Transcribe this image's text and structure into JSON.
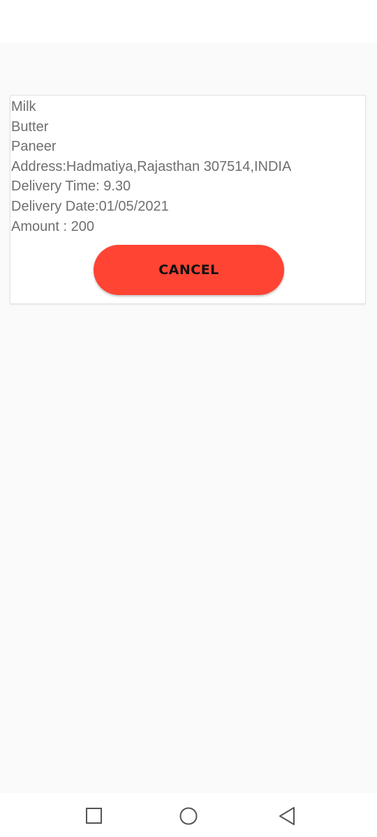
{
  "order": {
    "items": [
      "Milk",
      "Butter",
      "Paneer"
    ],
    "address": "Address:Hadmatiya,Rajasthan 307514,INDIA",
    "delivery_time": "Delivery Time: 9.30",
    "delivery_date": "Delivery Date:01/05/2021",
    "amount": "Amount : 200",
    "cancel_label": "CANCEL"
  },
  "colors": {
    "cancel_button": "#ff4433",
    "text": "#6f6f6f",
    "background": "#fafafa"
  },
  "nav": {
    "icons": [
      "square-recent-apps-icon",
      "circle-home-icon",
      "triangle-back-icon"
    ]
  }
}
